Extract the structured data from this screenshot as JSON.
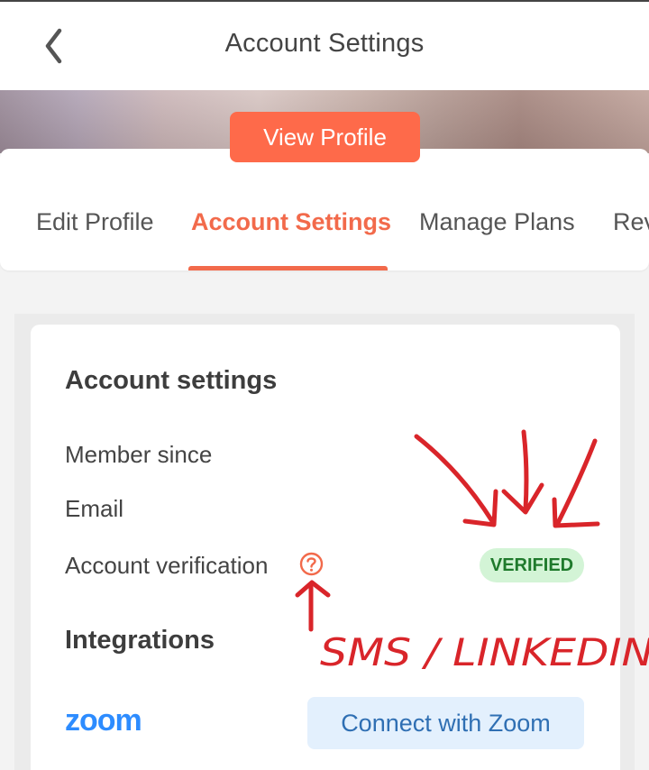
{
  "header": {
    "title": "Account Settings",
    "back_icon": "chevron-left-icon"
  },
  "profile": {
    "view_profile_label": "View Profile"
  },
  "tabs": [
    {
      "label": "Edit Profile",
      "active": false
    },
    {
      "label": "Account Settings",
      "active": true
    },
    {
      "label": "Manage Plans",
      "active": false
    },
    {
      "label": "Rev",
      "active": false
    }
  ],
  "account_settings": {
    "heading": "Account settings",
    "member_since_label": "Member since",
    "email_label": "Email",
    "verification_label": "Account verification",
    "help_icon": "question-circle-icon",
    "verification_status": "VERIFIED"
  },
  "integrations": {
    "heading": "Integrations",
    "zoom_logo": "zoom",
    "connect_label": "Connect with Zoom"
  },
  "annotation": {
    "handwritten_text": "SMS / LINKEDIN"
  },
  "colors": {
    "accent": "#fe6a4a",
    "verified_bg": "#d3f4d6",
    "verified_text": "#1f7a2c",
    "zoom_blue": "#2d8cff",
    "annotation_red": "#d9252a"
  }
}
